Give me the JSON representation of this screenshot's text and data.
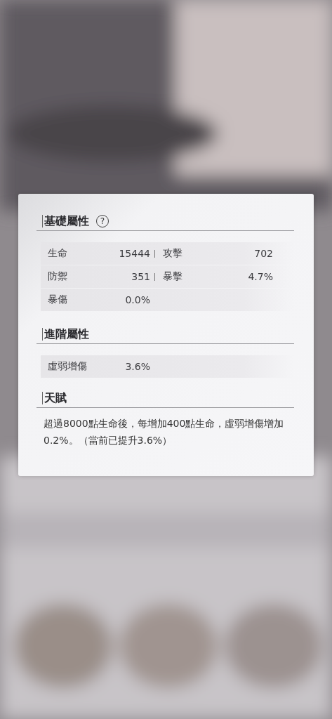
{
  "basic": {
    "title": "基礎屬性",
    "help": "?",
    "rows": [
      [
        {
          "label": "生命",
          "value": "15444"
        },
        {
          "label": "攻擊",
          "value": "702"
        }
      ],
      [
        {
          "label": "防禦",
          "value": "351"
        },
        {
          "label": "暴擊",
          "value": "4.7%"
        }
      ],
      [
        {
          "label": "暴傷",
          "value": "0.0%"
        }
      ]
    ]
  },
  "advanced": {
    "title": "進階屬性",
    "rows": [
      [
        {
          "label": "虛弱增傷",
          "value": "3.6%"
        }
      ]
    ]
  },
  "talent": {
    "title": "天賦",
    "text": "超過8000點生命後，每增加400點生命，虛弱增傷增加0.2%。（當前已提升3.6%）"
  }
}
